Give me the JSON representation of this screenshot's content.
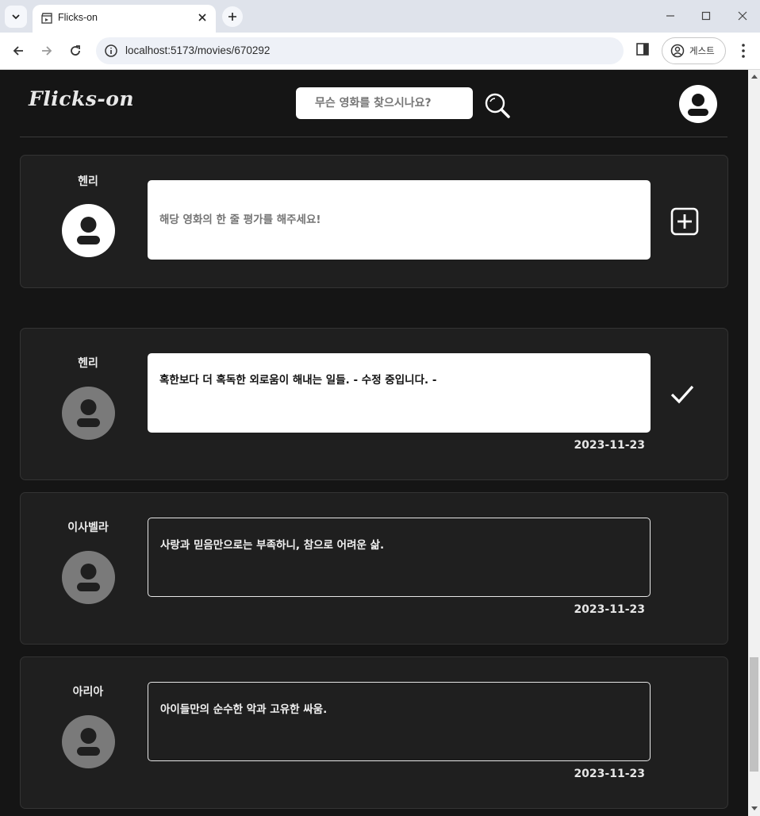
{
  "browser": {
    "tab_title": "Flicks-on",
    "url": "localhost:5173/movies/670292",
    "profile_label": "게스트"
  },
  "header": {
    "logo": "Flicks-on",
    "search_placeholder": "무슨 영화를 찾으시나요?"
  },
  "new_review": {
    "user": "헨리",
    "placeholder": "해당 영화의 한 줄 평가를 해주세요!"
  },
  "reviews": [
    {
      "user": "헨리",
      "text": "혹한보다 더 혹독한 외로움이 해내는 일들. - 수정 중입니다. -",
      "date": "2023-11-23",
      "editing": true
    },
    {
      "user": "이사벨라",
      "text": "사랑과 믿음만으로는 부족하니, 참으로 어려운 삶.",
      "date": "2023-11-23",
      "editing": false
    },
    {
      "user": "아리아",
      "text": "아이들만의 순수한 악과 고유한 싸움.",
      "date": "2023-11-23",
      "editing": false
    }
  ],
  "colors": {
    "page_bg": "#151515",
    "card_bg": "#1f1f1f",
    "avatar_active": "#ffffff",
    "avatar_inactive": "#7a7a7a"
  }
}
